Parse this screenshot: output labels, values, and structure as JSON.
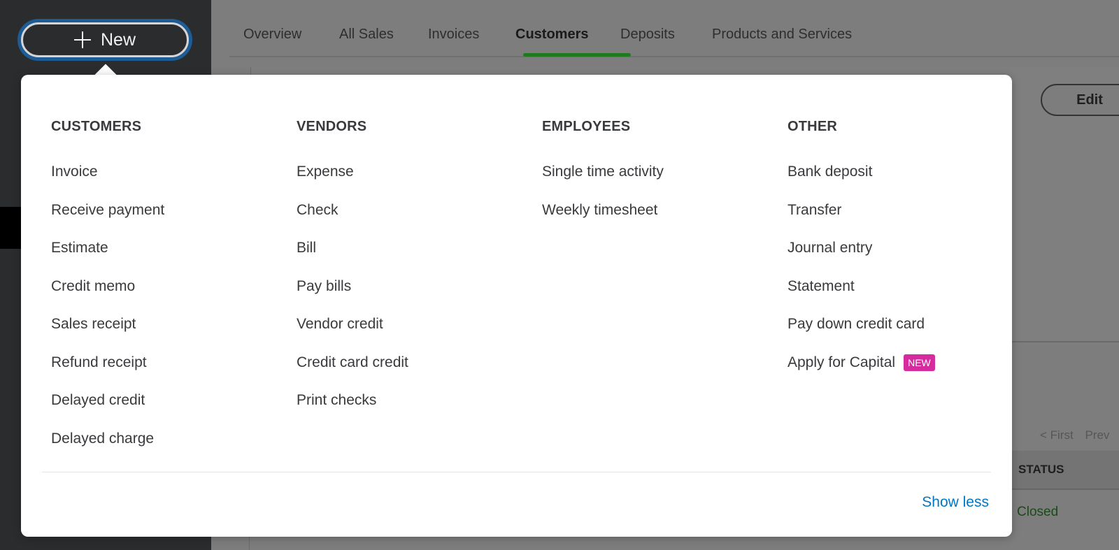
{
  "new_button": {
    "label": "New"
  },
  "tabs": [
    {
      "label": "Overview",
      "active": false
    },
    {
      "label": "All Sales",
      "active": false
    },
    {
      "label": "Invoices",
      "active": false
    },
    {
      "label": "Customers",
      "active": true
    },
    {
      "label": "Deposits",
      "active": false
    },
    {
      "label": "Products and Services",
      "active": false
    }
  ],
  "background": {
    "edit_label": "Edit",
    "pager": {
      "first": "< First",
      "prev": "Prev"
    },
    "table_header_status": "STATUS",
    "status_value": "Closed"
  },
  "menu": {
    "columns": [
      {
        "heading": "CUSTOMERS",
        "items": [
          "Invoice",
          "Receive payment",
          "Estimate",
          "Credit memo",
          "Sales receipt",
          "Refund receipt",
          "Delayed credit",
          "Delayed charge"
        ]
      },
      {
        "heading": "VENDORS",
        "items": [
          "Expense",
          "Check",
          "Bill",
          "Pay bills",
          "Vendor credit",
          "Credit card credit",
          "Print checks"
        ]
      },
      {
        "heading": "EMPLOYEES",
        "items": [
          "Single time activity",
          "Weekly timesheet"
        ]
      },
      {
        "heading": "OTHER",
        "items": [
          "Bank deposit",
          "Transfer",
          "Journal entry",
          "Statement",
          "Pay down credit card",
          "Apply for Capital"
        ]
      }
    ],
    "new_badge": "NEW",
    "show_less": "Show less"
  },
  "colors": {
    "accent_blue": "#0077c5",
    "active_tab_green": "#1f7a1f",
    "badge_pink": "#d52b9e"
  }
}
